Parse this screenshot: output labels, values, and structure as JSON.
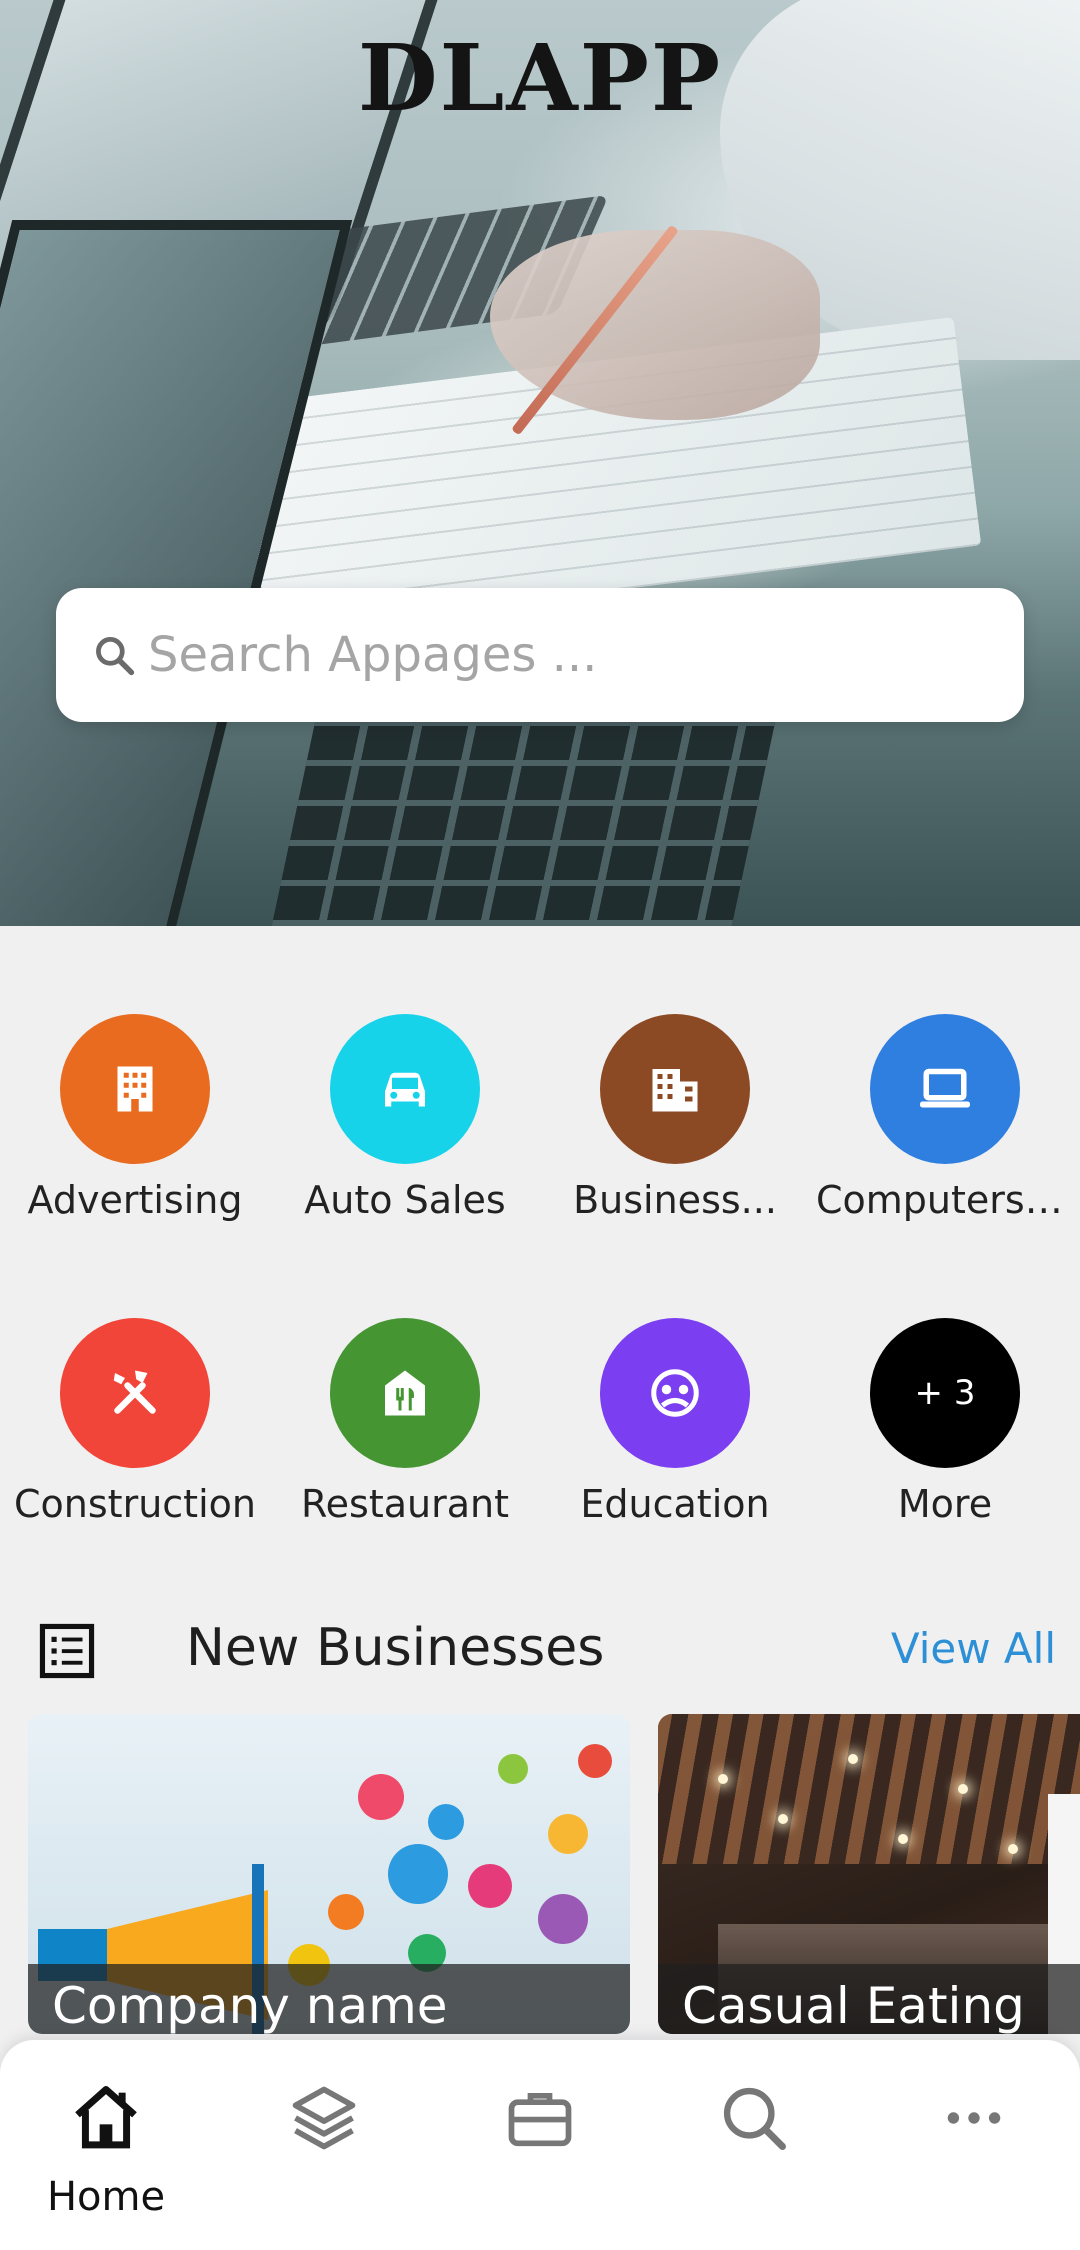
{
  "app": {
    "title": "DLAPP"
  },
  "search": {
    "placeholder": "Search Appages ..."
  },
  "categories": [
    {
      "label": "Advertising",
      "icon": "building-icon",
      "color": "#e86b1f"
    },
    {
      "label": "Auto Sales",
      "icon": "car-icon",
      "color": "#17d3ea"
    },
    {
      "label": "Business...",
      "icon": "office-building-icon",
      "color": "#8b4a24"
    },
    {
      "label": "Computers &...",
      "icon": "laptop-icon",
      "color": "#2f7fe1"
    },
    {
      "label": "Construction",
      "icon": "tools-icon",
      "color": "#f2453a"
    },
    {
      "label": "Restaurant",
      "icon": "restaurant-icon",
      "color": "#459533"
    },
    {
      "label": "Education",
      "icon": "education-icon",
      "color": "#7b3ff1"
    },
    {
      "label": "More",
      "icon": "more-badge",
      "badge": "+ 3",
      "color": "#000000"
    }
  ],
  "new_businesses": {
    "title": "New Businesses",
    "view_all": "View All",
    "cards": [
      {
        "title": "Company name"
      },
      {
        "title": "Casual Eating"
      }
    ]
  },
  "bottom_nav": {
    "items": [
      {
        "label": "Home",
        "icon": "home-icon",
        "active": true
      },
      {
        "icon": "layers-icon"
      },
      {
        "icon": "briefcase-icon"
      },
      {
        "icon": "search-icon"
      },
      {
        "icon": "more-horizontal-icon"
      }
    ]
  }
}
